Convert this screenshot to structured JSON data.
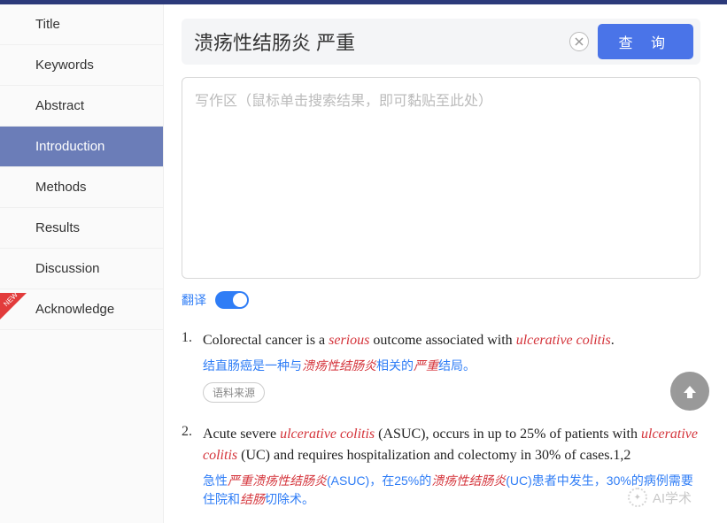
{
  "sidebar": {
    "items": [
      {
        "label": "Title"
      },
      {
        "label": "Keywords"
      },
      {
        "label": "Abstract"
      },
      {
        "label": "Introduction",
        "active": true
      },
      {
        "label": "Methods"
      },
      {
        "label": "Results"
      },
      {
        "label": "Discussion"
      },
      {
        "label": "Acknowledge",
        "new": true
      }
    ]
  },
  "search": {
    "value": "溃疡性结肠炎 严重",
    "query_btn": "查 询"
  },
  "writing": {
    "placeholder": "写作区（鼠标单击搜索结果，即可黏贴至此处）"
  },
  "translate": {
    "label": "翻译",
    "on": true
  },
  "results": [
    {
      "num": "1.",
      "en_parts": [
        {
          "t": "Colorectal cancer is a "
        },
        {
          "t": "serious",
          "hl": true
        },
        {
          "t": " outcome associated with "
        },
        {
          "t": "ulcerative colitis",
          "hl": true
        },
        {
          "t": "."
        }
      ],
      "cn_parts": [
        {
          "t": "结直肠癌是一种与"
        },
        {
          "t": "溃疡性结肠炎",
          "hl": true
        },
        {
          "t": "相关的"
        },
        {
          "t": "严重",
          "hl": true
        },
        {
          "t": "结局。"
        }
      ],
      "source_label": "语料来源"
    },
    {
      "num": "2.",
      "en_parts": [
        {
          "t": "Acute severe "
        },
        {
          "t": "ulcerative colitis",
          "hl": true
        },
        {
          "t": " (ASUC), occurs in up to 25% of patients with "
        },
        {
          "t": "ulcerative colitis",
          "hl": true
        },
        {
          "t": " (UC) and requires hospitalization and colectomy in 30% of cases.1,2"
        }
      ],
      "cn_parts": [
        {
          "t": "急性"
        },
        {
          "t": "严重溃疡性结肠炎",
          "hl": true
        },
        {
          "t": "(ASUC)，在25%的"
        },
        {
          "t": "溃疡性结肠炎",
          "hl": true
        },
        {
          "t": "(UC)患者中发生，30%的病例需要住院和"
        },
        {
          "t": "结肠",
          "hl": true
        },
        {
          "t": "切除术。"
        }
      ]
    }
  ],
  "watermark": {
    "text": "AI学术"
  }
}
